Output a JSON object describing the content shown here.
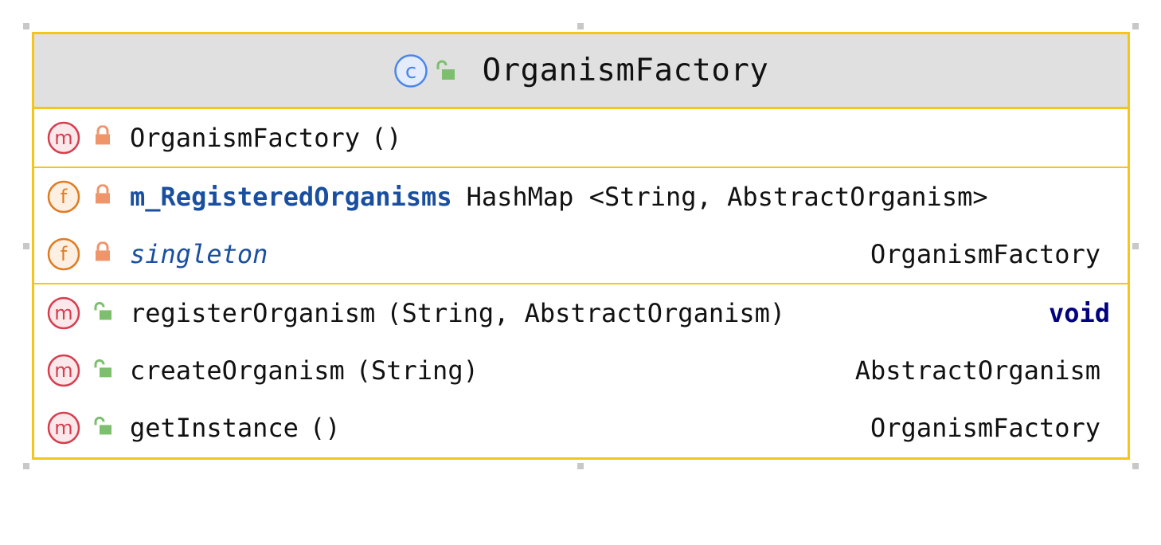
{
  "diagram": {
    "class_name": "OrganismFactory",
    "class_kind_icon": "class-c-icon",
    "class_visibility_icon": "public-unlock-icon",
    "colors": {
      "border": "#f5c518",
      "header_bg": "#e0e0e0",
      "method_icon": "#d63e4e",
      "field_icon": "#e07b22",
      "class_icon": "#4a86e8",
      "private_lock": "#f0956a",
      "public_lock": "#7dbf6e",
      "field_name": "#1a4fa0",
      "keyword": "#000080"
    },
    "constructors": [
      {
        "kind_icon": "method-m-icon",
        "visibility_icon": "private-lock-icon",
        "name": "OrganismFactory",
        "params": "()",
        "type": ""
      }
    ],
    "fields": [
      {
        "kind_icon": "field-f-icon",
        "visibility_icon": "private-lock-icon",
        "name": "m_RegisteredOrganisms",
        "type": "HashMap <String, AbstractOrganism>"
      },
      {
        "kind_icon": "field-f-icon",
        "visibility_icon": "private-lock-icon",
        "name": "singleton",
        "type": "OrganismFactory"
      }
    ],
    "methods": [
      {
        "kind_icon": "method-m-icon",
        "visibility_icon": "public-unlock-icon",
        "name": "registerOrganism",
        "params": "(String, AbstractOrganism)",
        "type": "void"
      },
      {
        "kind_icon": "method-m-icon",
        "visibility_icon": "public-unlock-icon",
        "name": "createOrganism",
        "params": "(String)",
        "type": "AbstractOrganism"
      },
      {
        "kind_icon": "method-m-icon",
        "visibility_icon": "public-unlock-icon",
        "name": "getInstance",
        "params": "()",
        "type": "OrganismFactory"
      }
    ]
  }
}
